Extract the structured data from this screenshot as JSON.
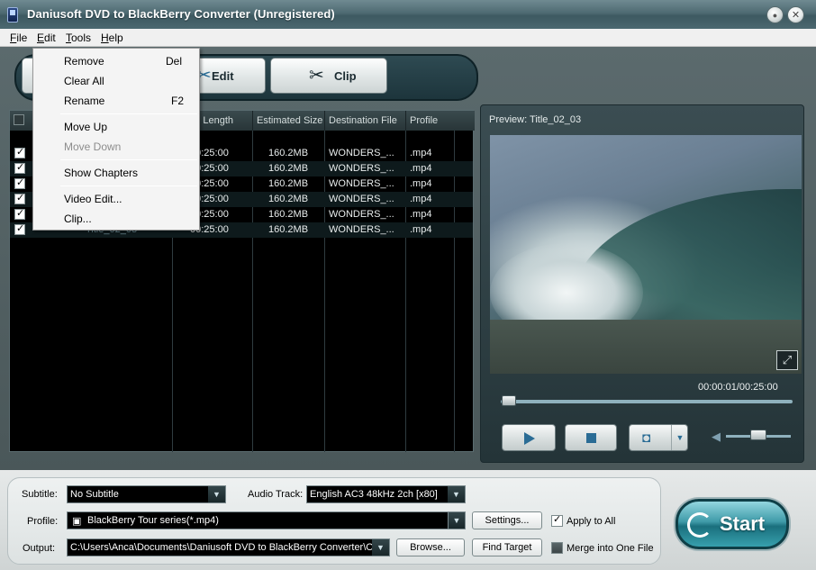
{
  "window": {
    "title": "Daniusoft DVD to BlackBerry Converter (Unregistered)",
    "minimize_glyph": "●",
    "close_glyph": "✕"
  },
  "menubar": [
    {
      "label": "File",
      "accel": "F",
      "rest": "ile"
    },
    {
      "label": "Edit",
      "accel": "E",
      "rest": "dit"
    },
    {
      "label": "Tools",
      "accel": "T",
      "rest": "ools"
    },
    {
      "label": "Help",
      "accel": "H",
      "rest": "elp"
    }
  ],
  "toolbar": {
    "edit_label": "Edit",
    "clip_label": "Clip"
  },
  "edit_menu": {
    "items": [
      {
        "label": "Remove",
        "shortcut": "Del",
        "enabled": true
      },
      {
        "label": "Clear All",
        "shortcut": "",
        "enabled": true
      },
      {
        "label": "Rename",
        "shortcut": "F2",
        "enabled": true
      },
      {
        "label": "Move Up",
        "shortcut": "",
        "enabled": true
      },
      {
        "label": "Move Down",
        "shortcut": "",
        "enabled": false
      },
      {
        "label": "Show Chapters",
        "shortcut": "",
        "enabled": true
      },
      {
        "label": "Video Edit...",
        "shortcut": "",
        "enabled": true
      },
      {
        "label": "Clip...",
        "shortcut": "",
        "enabled": true
      }
    ]
  },
  "file_list": {
    "columns": [
      "ned Length",
      "Estimated Size",
      "Destination File",
      "Profile"
    ],
    "rows": [
      {
        "checked": true,
        "length": "00:25:00",
        "size": "160.2MB",
        "dest": "WONDERS_...",
        "profile": ".mp4"
      },
      {
        "checked": true,
        "length": "00:25:00",
        "size": "160.2MB",
        "dest": "WONDERS_...",
        "profile": ".mp4"
      },
      {
        "checked": true,
        "length": "00:25:00",
        "size": "160.2MB",
        "dest": "WONDERS_...",
        "profile": ".mp4"
      },
      {
        "checked": true,
        "length": "00:25:00",
        "size": "160.2MB",
        "dest": "WONDERS_...",
        "profile": ".mp4"
      },
      {
        "checked": true,
        "length": "00:25:00",
        "size": "160.2MB",
        "dest": "WONDERS_...",
        "profile": ".mp4"
      },
      {
        "checked": true,
        "length": "00:25:00",
        "size": "160.2MB",
        "dest": "WONDERS_...",
        "profile": ".mp4"
      }
    ],
    "partial_title": "Title_02_03"
  },
  "preview": {
    "title": "Preview: Title_02_03",
    "time": "00:00:01/00:25:00",
    "seek_fraction": 0.01,
    "volume_fraction": 0.5
  },
  "settings": {
    "subtitle_label": "Subtitle:",
    "subtitle_value": "No Subtitle",
    "audio_label": "Audio Track:",
    "audio_value": "English AC3 48kHz 2ch [x80]",
    "profile_label": "Profile:",
    "profile_value": "BlackBerry Tour series(*.mp4)",
    "settings_button": "Settings...",
    "apply_all_label": "Apply to All",
    "apply_all_checked": true,
    "output_label": "Output:",
    "output_value": "C:\\Users\\Anca\\Documents\\Daniusoft DVD to BlackBerry Converter\\Ou",
    "browse_button": "Browse...",
    "find_target_button": "Find Target",
    "merge_label": "Merge into One File",
    "merge_checked": false,
    "start_label": "Start"
  },
  "colors": {
    "accent": "#2a6c95",
    "titlebar": "#4e6a72",
    "start": "#3e9aa8"
  }
}
